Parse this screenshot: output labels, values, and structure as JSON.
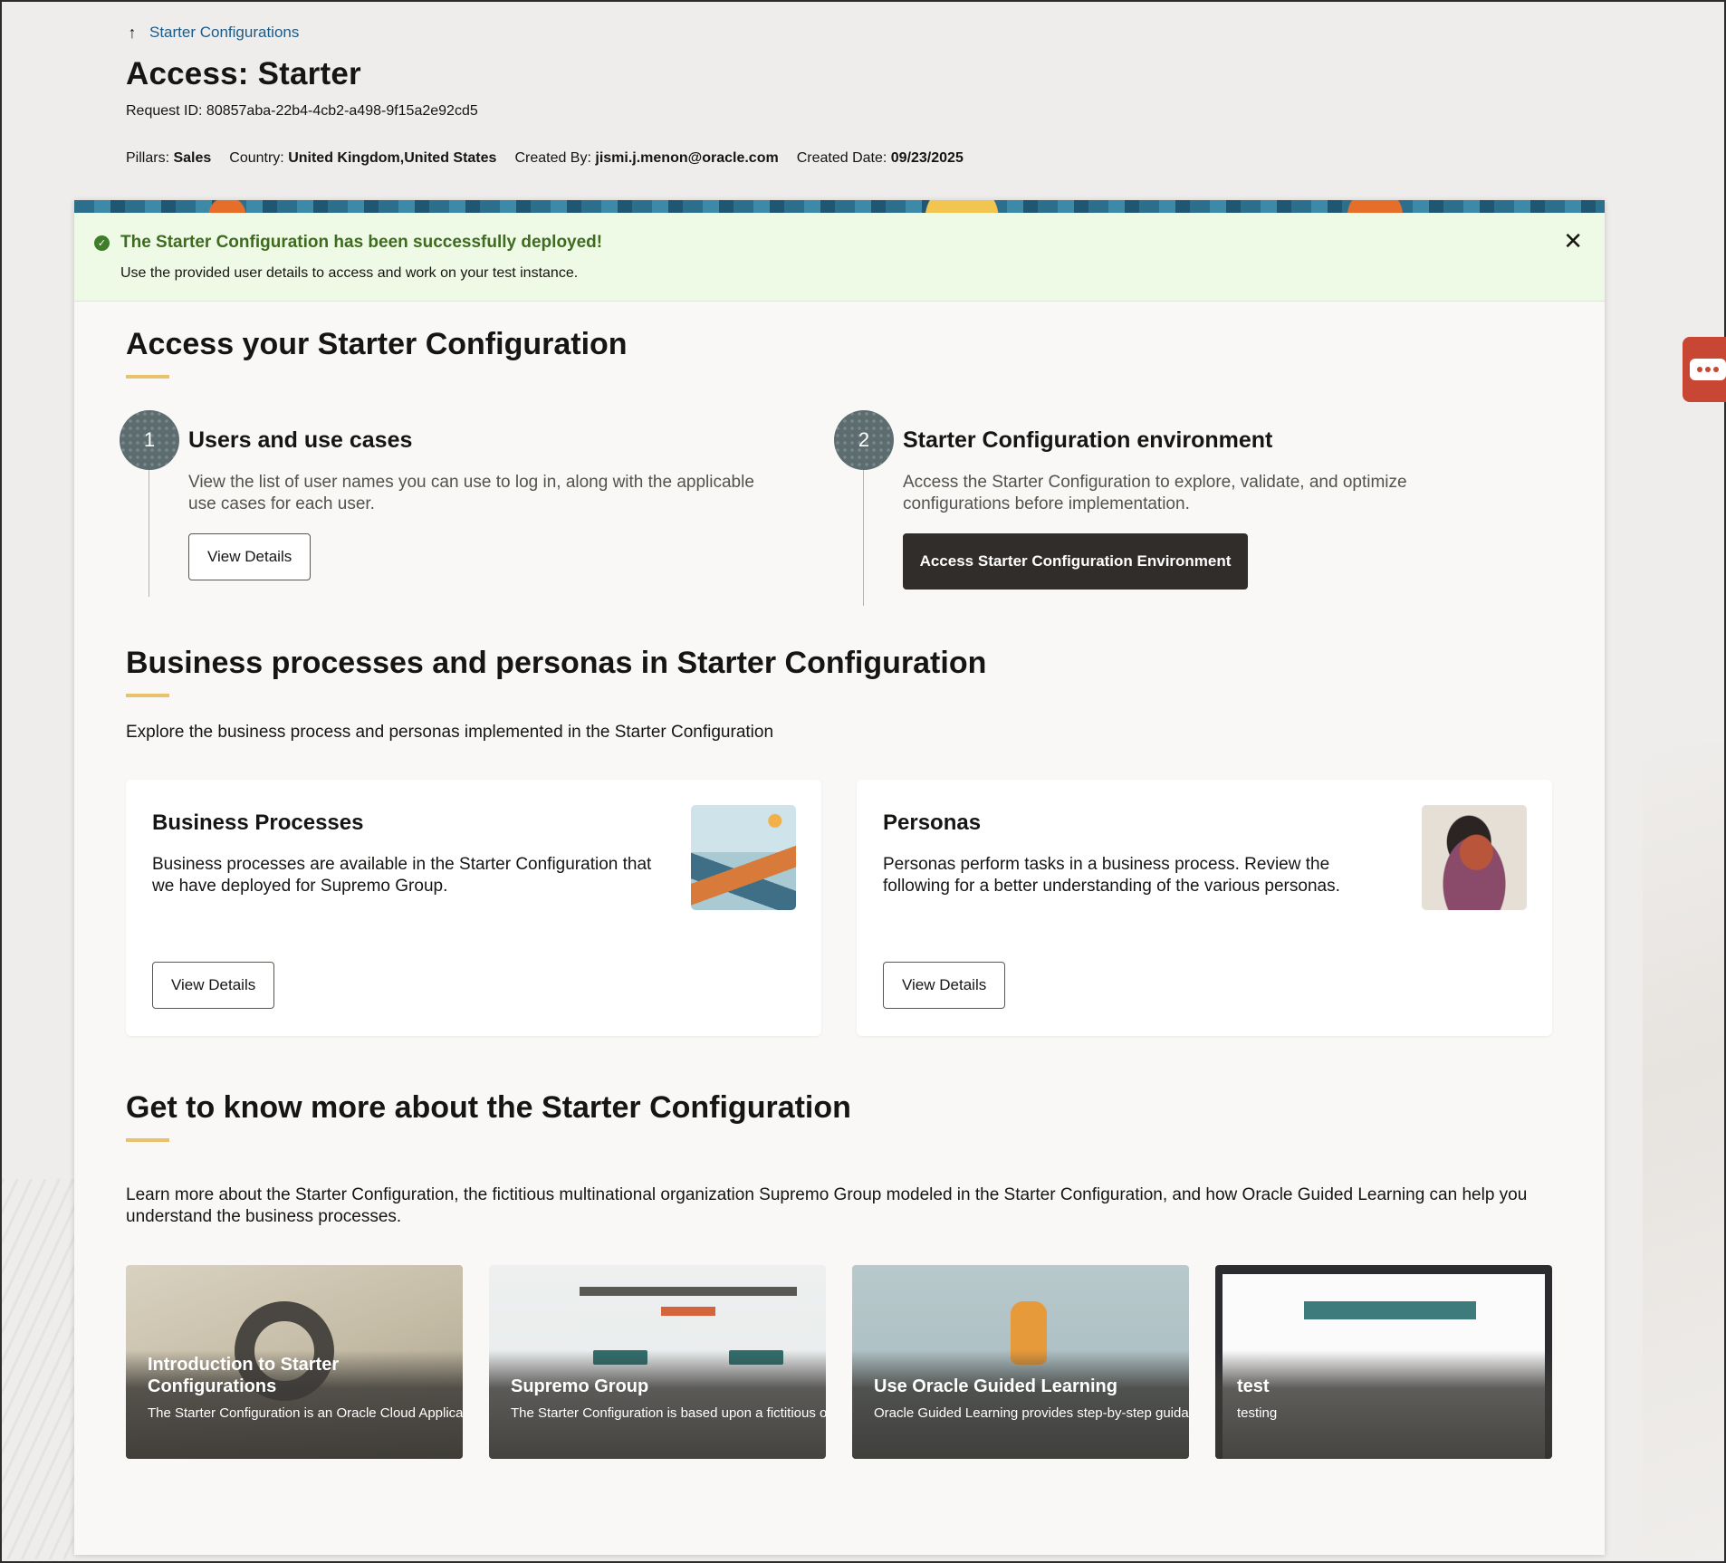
{
  "header": {
    "back_link": "Starter Configurations",
    "title": "Access: Starter",
    "request_id": "Request ID: 80857aba-22b4-4cb2-a498-9f15a2e92cd5",
    "meta": {
      "pillars_label": "Pillars:",
      "pillars_value": "Sales",
      "country_label": "Country:",
      "country_value": "United Kingdom,United States",
      "created_by_label": "Created By:",
      "created_by_value": "jismi.j.menon@oracle.com",
      "created_date_label": "Created Date:",
      "created_date_value": "09/23/2025"
    }
  },
  "alert": {
    "title": "The Starter Configuration has been successfully deployed!",
    "message": "Use the provided user details to access and work on your test instance.",
    "close_glyph": "✕"
  },
  "access_section": {
    "title": "Access your Starter Configuration",
    "steps": [
      {
        "number": "1",
        "heading": "Users and use cases",
        "description": "View the list of user names you can use to log in, along with the applicable use cases for each user.",
        "button": "View Details"
      },
      {
        "number": "2",
        "heading": "Starter Configuration environment",
        "description": "Access the Starter Configuration to explore, validate, and optimize configurations before implementation.",
        "button": "Access Starter Configuration Environment"
      }
    ]
  },
  "bp_section": {
    "title": "Business processes and personas in Starter Configuration",
    "description": "Explore the business process and personas implemented in the Starter Configuration",
    "cards": [
      {
        "title": "Business Processes",
        "description": "Business processes are available in the Starter Configuration that we have deployed for Supremo Group.",
        "button": "View Details"
      },
      {
        "title": "Personas",
        "description": "Personas perform tasks in a business process. Review the following for a better understanding of the various personas.",
        "button": "View Details"
      }
    ]
  },
  "learn_section": {
    "title": "Get to know more about the Starter Configuration",
    "description": "Learn more about the Starter Configuration, the fictitious multinational organization Supremo Group modeled in the Starter Configuration, and how Oracle Guided Learning can help you understand the business processes.",
    "tiles": [
      {
        "title": "Introduction to Starter Configurations",
        "description": "The Starter Configuration is an Oracle Cloud Applicati"
      },
      {
        "title": "Supremo Group",
        "description": "The Starter Configuration is based upon a fictitious or"
      },
      {
        "title": "Use Oracle Guided Learning",
        "description": "Oracle Guided Learning provides step-by-step guidan"
      },
      {
        "title": "test",
        "description": "testing"
      }
    ]
  },
  "icons": {
    "back": "arrow-up-icon",
    "success": "check-circle-icon",
    "close": "close-icon",
    "chat": "chat-icon"
  },
  "colors": {
    "link": "#1d5a86",
    "success_text": "#3f6b1f",
    "success_bg": "#eefae6",
    "accent_underline": "#e9c26b",
    "dark_button": "#312d2a",
    "chat_tab": "#c74634"
  }
}
